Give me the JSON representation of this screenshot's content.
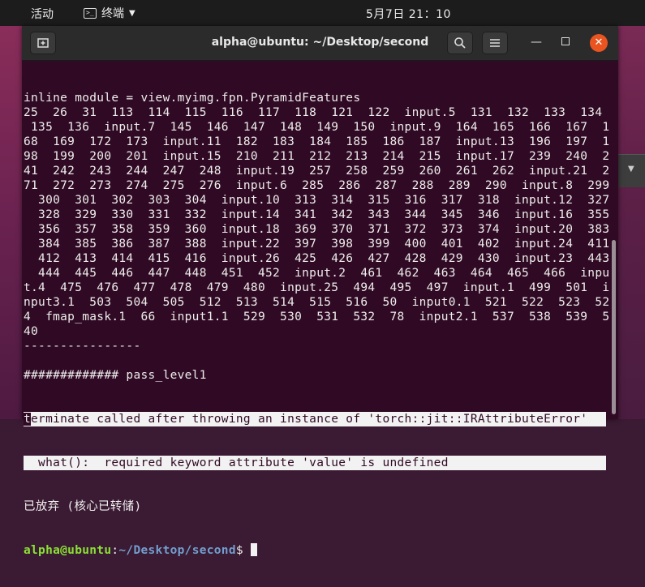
{
  "topbar": {
    "activities": "活动",
    "app_name": "终端",
    "clock": "5月7日  21：10"
  },
  "window": {
    "title": "alpha@ubuntu: ~/Desktop/second"
  },
  "terminal": {
    "lines": [
      "inline module = view.myimg.fpn.PyramidFeatures",
      "25  26  31  113  114  115  116  117  118  121  122  input.5  131  132  133  134",
      " 135  136  input.7  145  146  147  148  149  150  input.9  164  165  166  167  1",
      "68  169  172  173  input.11  182  183  184  185  186  187  input.13  196  197  1",
      "98  199  200  201  input.15  210  211  212  213  214  215  input.17  239  240  2",
      "41  242  243  244  247  248  input.19  257  258  259  260  261  262  input.21  2",
      "71  272  273  274  275  276  input.6  285  286  287  288  289  290  input.8  299",
      "  300  301  302  303  304  input.10  313  314  315  316  317  318  input.12  327",
      "  328  329  330  331  332  input.14  341  342  343  344  345  346  input.16  355",
      "  356  357  358  359  360  input.18  369  370  371  372  373  374  input.20  383",
      "  384  385  386  387  388  input.22  397  398  399  400  401  402  input.24  411",
      "  412  413  414  415  416  input.26  425  426  427  428  429  430  input.23  443",
      "  444  445  446  447  448  451  452  input.2  461  462  463  464  465  466  inpu",
      "t.4  475  476  477  478  479  480  input.25  494  495  497  input.1  499  501  i",
      "nput3.1  503  504  505  512  513  514  515  516  50  input0.1  521  522  523  52",
      "4  fmap_mask.1  66  input1.1  529  530  531  532  78  input2.1  537  538  539  5",
      "40",
      "----------------",
      "",
      "############# pass_level1"
    ],
    "error_line1_first_char": "t",
    "error_line1_rest": "erminate called after throwing an instance of 'torch::jit::IRAttributeError'",
    "error_line2": "  what():  required keyword attribute 'value' is undefined",
    "abort_line": "已放弃 (核心已转储)",
    "prompt_user": "alpha@ubuntu",
    "prompt_sep": ":",
    "prompt_path": "~/Desktop/second",
    "prompt_symbol": "$ "
  }
}
